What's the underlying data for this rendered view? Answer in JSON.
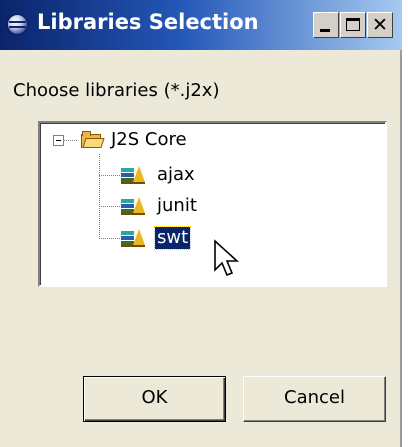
{
  "window": {
    "title": "Libraries Selection",
    "controls": {
      "minimize": "_",
      "maximize": "□",
      "close": "✕"
    }
  },
  "prompt": "Choose libraries (*.j2x)",
  "tree": {
    "root": {
      "label": "J2S Core",
      "expanded": true,
      "icon": "folder-open-icon"
    },
    "children": [
      {
        "label": "ajax",
        "icon": "library-icon",
        "selected": false
      },
      {
        "label": "junit",
        "icon": "library-icon",
        "selected": false
      },
      {
        "label": "swt",
        "icon": "library-icon",
        "selected": true
      }
    ]
  },
  "buttons": {
    "ok": "OK",
    "cancel": "Cancel"
  },
  "colors": {
    "selection": "#0a246a",
    "title_bar_start": "#0a246a",
    "title_bar_end": "#a6caf0"
  }
}
